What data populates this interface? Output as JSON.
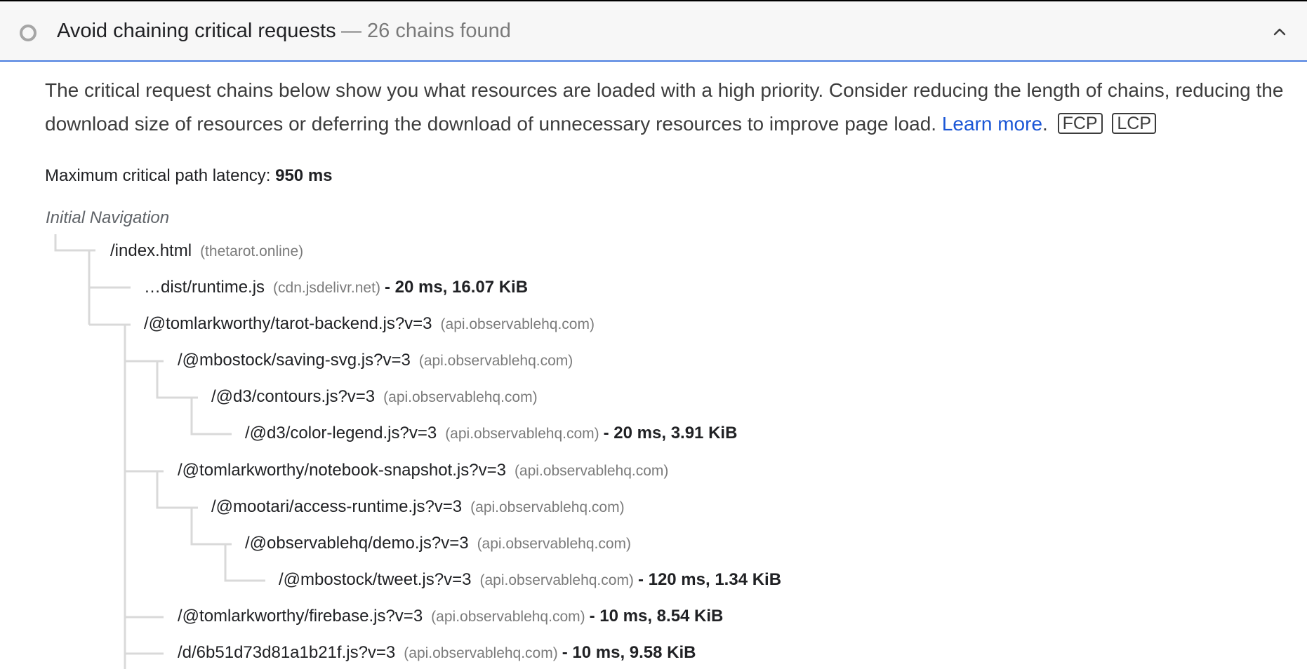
{
  "audit": {
    "title": "Avoid chaining critical requests",
    "display_value": "— 26 chains found",
    "status_icon": "circle-informative-icon",
    "toggle_icon": "chevron-up-icon"
  },
  "description": {
    "text": "The critical request chains below show you what resources are loaded with a high priority. Consider reducing the length of chains, reducing the download size of resources or deferring the download of unnecessary resources to improve page load.",
    "link_label": "Learn more",
    "link_suffix": ".",
    "badges": [
      "FCP",
      "LCP"
    ]
  },
  "latency": {
    "label": "Maximum critical path latency:",
    "value": "950 ms"
  },
  "tree": {
    "root_label": "Initial Navigation",
    "nodes": [
      {
        "url": "/index.html",
        "host": "(thetarot.online)",
        "stats": ""
      },
      {
        "url": "…dist/runtime.js",
        "host": "(cdn.jsdelivr.net)",
        "stats": "- 20 ms, 16.07 KiB"
      },
      {
        "url": "/@tomlarkworthy/tarot-backend.js?v=3",
        "host": "(api.observablehq.com)",
        "stats": ""
      },
      {
        "url": "/@mbostock/saving-svg.js?v=3",
        "host": "(api.observablehq.com)",
        "stats": ""
      },
      {
        "url": "/@d3/contours.js?v=3",
        "host": "(api.observablehq.com)",
        "stats": ""
      },
      {
        "url": "/@d3/color-legend.js?v=3",
        "host": "(api.observablehq.com)",
        "stats": "- 20 ms, 3.91 KiB"
      },
      {
        "url": "/@tomlarkworthy/notebook-snapshot.js?v=3",
        "host": "(api.observablehq.com)",
        "stats": ""
      },
      {
        "url": "/@mootari/access-runtime.js?v=3",
        "host": "(api.observablehq.com)",
        "stats": ""
      },
      {
        "url": "/@observablehq/demo.js?v=3",
        "host": "(api.observablehq.com)",
        "stats": ""
      },
      {
        "url": "/@mbostock/tweet.js?v=3",
        "host": "(api.observablehq.com)",
        "stats": "- 120 ms, 1.34 KiB"
      },
      {
        "url": "/@tomlarkworthy/firebase.js?v=3",
        "host": "(api.observablehq.com)",
        "stats": "- 10 ms, 8.54 KiB"
      },
      {
        "url": "/d/6b51d73d81a1b21f.js?v=3",
        "host": "(api.observablehq.com)",
        "stats": "- 10 ms, 9.58 KiB"
      }
    ]
  },
  "colors": {
    "accent": "#4b7ee0",
    "link": "#1a56d6",
    "tree_line": "#d9d9d9",
    "host_text": "#7b7b7b"
  }
}
